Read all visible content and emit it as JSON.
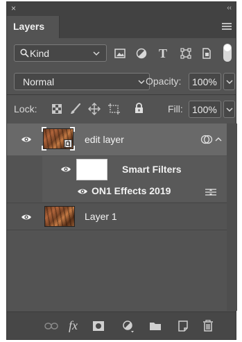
{
  "window": {
    "close_glyph": "×",
    "collapse_glyph": "‹‹"
  },
  "tab": {
    "label": "Layers",
    "menu_icon": "panel-menu-icon"
  },
  "filter": {
    "kind_label": "Kind",
    "kind_icon": "search-icon",
    "icons": [
      "image-filter-icon",
      "adjustment-filter-icon",
      "type-filter-icon",
      "shape-filter-icon",
      "smart-object-filter-icon"
    ],
    "type_glyph": "T"
  },
  "blend": {
    "mode": "Normal",
    "opacity_label": "Opacity:",
    "opacity_value": "100%"
  },
  "lock": {
    "label": "Lock:",
    "icons": [
      "lock-transparent-pixels-icon",
      "lock-image-pixels-icon",
      "lock-position-icon",
      "lock-artboard-icon",
      "lock-all-icon"
    ],
    "fill_label": "Fill:",
    "fill_value": "100%"
  },
  "layers": [
    {
      "name": "edit layer",
      "selected": true,
      "smart_object": true
    },
    {
      "name": "Layer 1",
      "selected": false,
      "smart_object": false
    }
  ],
  "smart_filters": {
    "label": "Smart Filters",
    "effects": [
      {
        "name": "ON1 Effects 2019"
      }
    ]
  },
  "bottom_bar": {
    "fx_label": "fx",
    "icons": [
      "link-layers-icon",
      "add-layer-style-icon",
      "add-mask-icon",
      "new-adjustment-layer-icon",
      "new-group-icon",
      "new-layer-icon",
      "delete-layer-icon"
    ]
  },
  "colors": {
    "panel_bg": "#535353",
    "selected_row": "#696969",
    "header_bg": "#424242"
  }
}
